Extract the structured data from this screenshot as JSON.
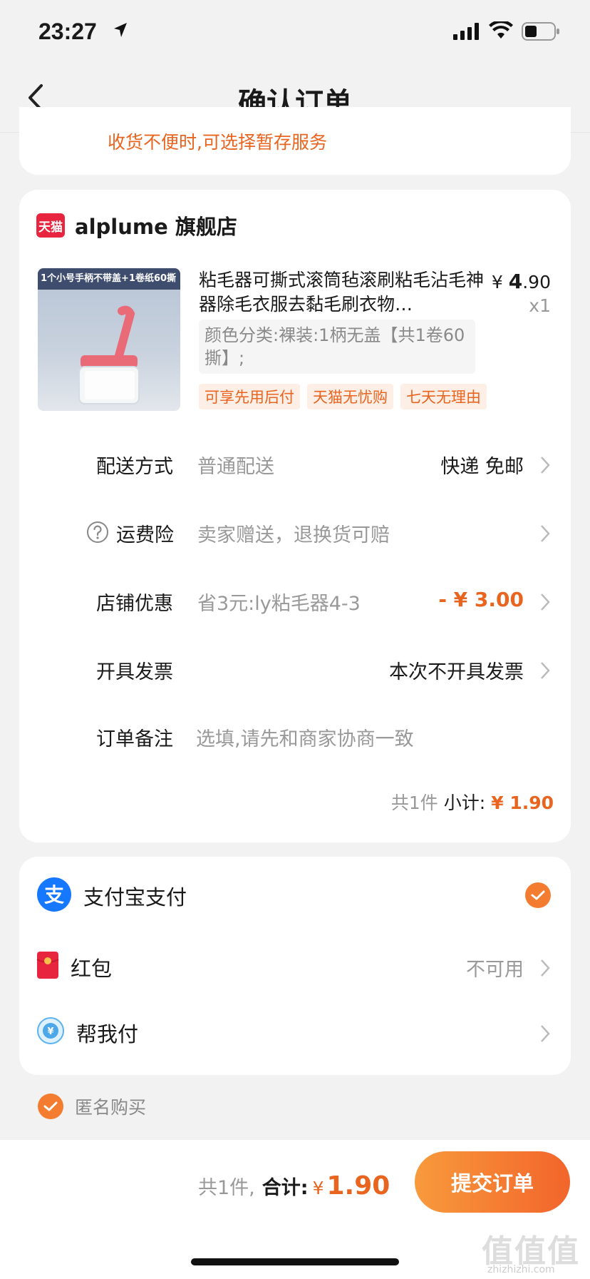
{
  "status_bar": {
    "time": "23:27"
  },
  "nav": {
    "title": "确认订单"
  },
  "top_card": {
    "warning": "收货不便时,可选择暂存服务"
  },
  "store": {
    "logo_text": "天猫",
    "name": "alplume 旗舰店",
    "product": {
      "image_banner": "1个小号手柄不带盖+1卷纸60撕",
      "title": "粘毛器可撕式滚筒毡滚刷粘毛沾毛神器除毛衣服去黏毛刷衣物…",
      "price_symbol": "¥ ",
      "price_int": "4",
      "price_dec": ".90",
      "qty": "x1",
      "sku": "颜色分类:裸装:1柄无盖【共1卷60撕】;",
      "tags": [
        "可享先用后付",
        "天猫无忧购",
        "七天无理由"
      ]
    },
    "rows": {
      "delivery": {
        "label": "配送方式",
        "value": "普通配送",
        "right": "快递 免邮"
      },
      "insurance": {
        "label": "运费险",
        "value": "卖家赠送，退换货可赔"
      },
      "discount": {
        "label": "店铺优惠",
        "value": "省3元:ly粘毛器4-3",
        "right": "- ¥ 3.00"
      },
      "invoice": {
        "label": "开具发票",
        "right": "本次不开具发票"
      },
      "note": {
        "label": "订单备注",
        "placeholder": "选填,请先和商家协商一致"
      }
    },
    "subtotal": {
      "count": "共1件",
      "label": "小计:",
      "amount": "¥ 1.90"
    }
  },
  "payment": {
    "alipay": {
      "label": "支付宝支付"
    },
    "redpacket": {
      "label": "红包",
      "right": "不可用"
    },
    "helppay": {
      "label": "帮我付"
    }
  },
  "anonymous": {
    "label": "匿名购买"
  },
  "bottom": {
    "count": "共1件,",
    "total_label": "合计:",
    "yen": "¥",
    "amount": "1.90",
    "submit": "提交订单"
  },
  "watermark": {
    "main": "值值值",
    "sub": "zhizhizhi.com"
  },
  "colors": {
    "accent": "#e9641f",
    "tmall_red": "#e8253f",
    "alipay_blue": "#1677ff"
  }
}
